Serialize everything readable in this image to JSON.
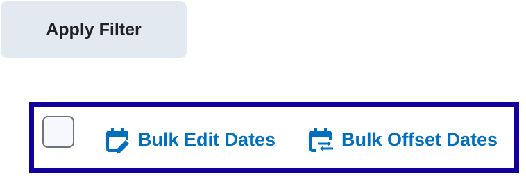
{
  "filter": {
    "apply_label": "Apply Filter"
  },
  "bulk_toolbar": {
    "edit_dates_label": "Bulk Edit Dates",
    "edit_dates_icon": "calendar-edit-icon",
    "offset_dates_label": "Bulk Offset Dates",
    "offset_dates_icon": "calendar-offset-icon",
    "select_all_checked": false
  },
  "colors": {
    "action_blue": "#006fbf",
    "focus_outline": "#11009e",
    "button_bg": "#e3e9f1",
    "button_text": "#202122"
  }
}
